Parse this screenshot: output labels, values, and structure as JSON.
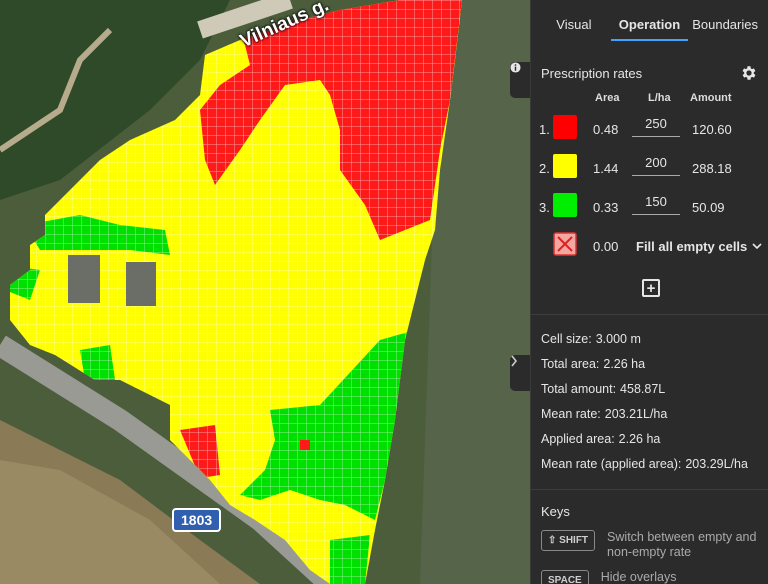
{
  "map": {
    "road_label": "Vilniaus g.",
    "road_badge": "1803",
    "info_icon": "info-icon",
    "expand_icon": "chevron-right-icon"
  },
  "tabs": [
    {
      "label": "Visual",
      "active": false
    },
    {
      "label": "Operation",
      "active": true
    },
    {
      "label": "Boundaries",
      "active": false
    }
  ],
  "prescription": {
    "title": "Prescription rates",
    "settings_icon": "gear-icon",
    "columns": {
      "area": "Area",
      "rate": "L/ha",
      "amount": "Amount"
    },
    "rates": [
      {
        "index": "1.",
        "color": "#ff0000",
        "area": "0.48",
        "rate": "250",
        "amount": "120.60"
      },
      {
        "index": "2.",
        "color": "#ffff00",
        "area": "1.44",
        "rate": "200",
        "amount": "288.18"
      },
      {
        "index": "3.",
        "color": "#00ee00",
        "area": "0.33",
        "rate": "150",
        "amount": "50.09"
      }
    ],
    "empty": {
      "area": "0.00",
      "fill_label": "Fill all empty cells"
    },
    "add_icon": "plus-square-icon"
  },
  "stats": [
    {
      "label": "Cell size:",
      "value": "3.000 m"
    },
    {
      "label": "Total area:",
      "value": "2.26 ha"
    },
    {
      "label": "Total amount:",
      "value": "458.87L"
    },
    {
      "label": "Mean rate:",
      "value": "203.21L/ha"
    },
    {
      "label": "Applied area:",
      "value": "2.26 ha"
    },
    {
      "label": "Mean rate (applied area):",
      "value": "203.29L/ha"
    }
  ],
  "keys": {
    "title": "Keys",
    "items": [
      {
        "key": "⇧ SHIFT",
        "desc": "Switch between empty and non-empty rate"
      },
      {
        "key": "SPACE",
        "desc": "Hide overlays"
      }
    ]
  }
}
